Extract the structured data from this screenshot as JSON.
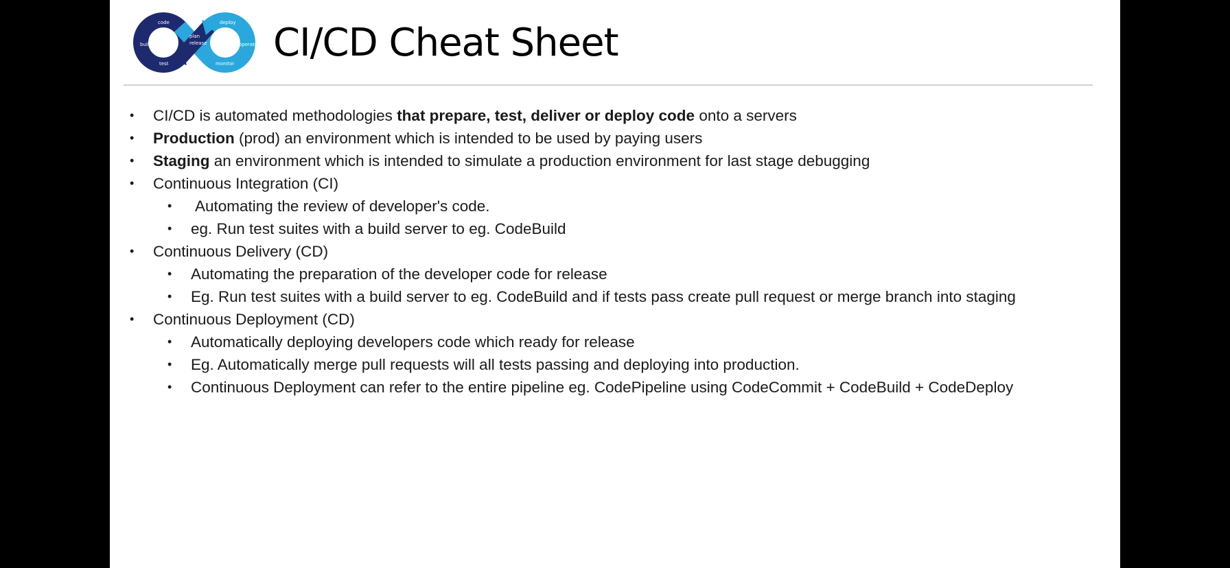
{
  "slide": {
    "title": "CI/CD Cheat Sheet",
    "logo": {
      "icon": "infinity-loop-logo",
      "colors": {
        "left_loop": "#1e2a6e",
        "right_loop": "#2aa7dd"
      },
      "labels": [
        "code",
        "build",
        "test",
        "release",
        "deploy",
        "operate",
        "monitor",
        "plan"
      ]
    }
  },
  "bullets": [
    {
      "level": 1,
      "parts": [
        {
          "text": "CI/CD is automated methodologies ",
          "bold": false
        },
        {
          "text": "that prepare, test, deliver or deploy code",
          "bold": true
        },
        {
          "text": " onto a servers",
          "bold": false
        }
      ]
    },
    {
      "level": 1,
      "parts": [
        {
          "text": "Production",
          "bold": true
        },
        {
          "text": " (prod) an environment which is intended to be used by paying users",
          "bold": false
        }
      ]
    },
    {
      "level": 1,
      "parts": [
        {
          "text": "Staging",
          "bold": true
        },
        {
          "text": " an environment which is intended to simulate a production environment for last stage debugging",
          "bold": false
        }
      ]
    },
    {
      "level": 1,
      "parts": [
        {
          "text": "Continuous Integration (CI)",
          "bold": false
        }
      ]
    },
    {
      "level": 2,
      "indent": true,
      "parts": [
        {
          "text": "Automating the review of developer's code.",
          "bold": false
        }
      ]
    },
    {
      "level": 2,
      "parts": [
        {
          "text": "eg. Run test suites with a build server to eg. CodeBuild",
          "bold": false
        }
      ]
    },
    {
      "level": 1,
      "parts": [
        {
          "text": "Continuous Delivery (CD)",
          "bold": false
        }
      ]
    },
    {
      "level": 2,
      "parts": [
        {
          "text": "Automating the preparation of the developer code for release",
          "bold": false
        }
      ]
    },
    {
      "level": 2,
      "parts": [
        {
          "text": "Eg. Run test suites with a build server to eg. CodeBuild and if tests pass create pull request or merge branch into staging",
          "bold": false
        }
      ]
    },
    {
      "level": 1,
      "parts": [
        {
          "text": "Continuous Deployment (CD)",
          "bold": false
        }
      ]
    },
    {
      "level": 2,
      "parts": [
        {
          "text": "Automatically deploying developers code which ready for release",
          "bold": false
        }
      ]
    },
    {
      "level": 2,
      "parts": [
        {
          "text": "Eg. Automatically merge pull requests will all tests passing and deploying into production.",
          "bold": false
        }
      ]
    },
    {
      "level": 2,
      "parts": [
        {
          "text": "Continuous Deployment can refer to the entire pipeline eg. CodePipeline using CodeCommit  + CodeBuild + CodeDeploy",
          "bold": false
        }
      ]
    }
  ]
}
